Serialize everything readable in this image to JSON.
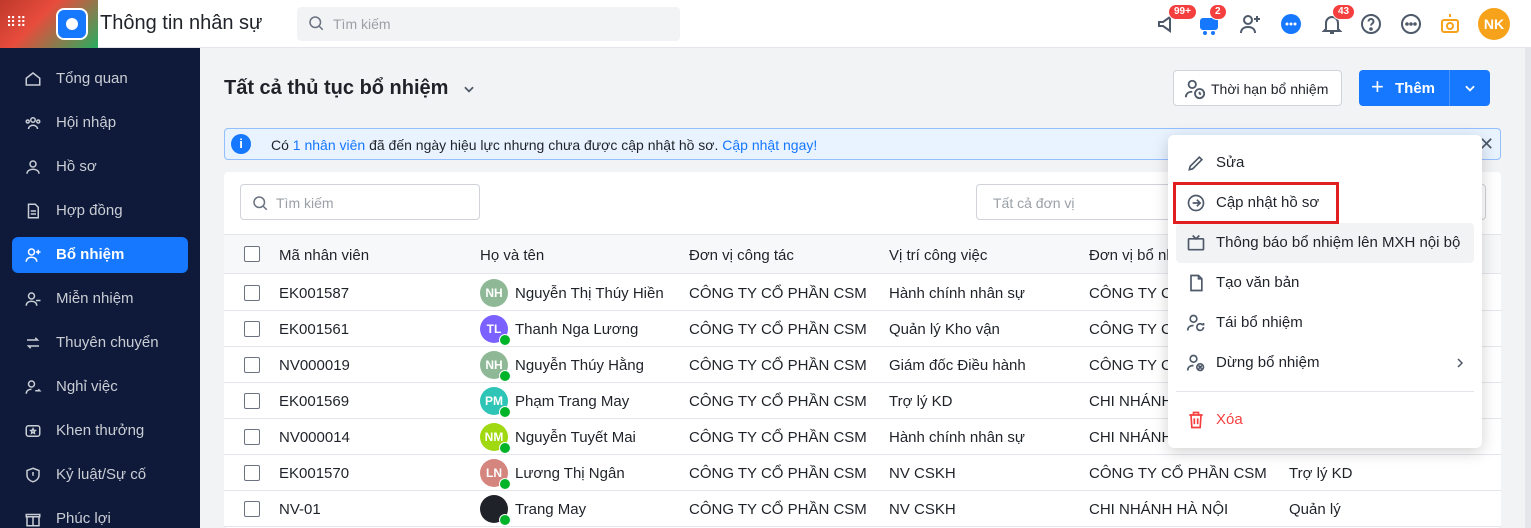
{
  "header": {
    "app_title": "Thông tin nhân sự",
    "search_placeholder": "Tìm kiếm",
    "badges": {
      "announce": "99+",
      "cart": "2",
      "notifications": "43"
    },
    "avatar_initials": "NK"
  },
  "sidebar": {
    "items": [
      {
        "label": "Tổng quan",
        "icon": "home-icon"
      },
      {
        "label": "Hội nhập",
        "icon": "users-group-icon"
      },
      {
        "label": "Hồ sơ",
        "icon": "user-icon"
      },
      {
        "label": "Hợp đồng",
        "icon": "document-icon"
      },
      {
        "label": "Bổ nhiệm",
        "icon": "user-plus-icon",
        "active": true
      },
      {
        "label": "Miễn nhiệm",
        "icon": "user-minus-icon"
      },
      {
        "label": "Thuyên chuyển",
        "icon": "transfer-icon"
      },
      {
        "label": "Nghỉ việc",
        "icon": "user-leave-icon"
      },
      {
        "label": "Khen thưởng",
        "icon": "award-icon"
      },
      {
        "label": "Kỷ luật/Sự cố",
        "icon": "shield-icon"
      },
      {
        "label": "Phúc lợi",
        "icon": "gift-icon"
      }
    ]
  },
  "main": {
    "title": "Tất cả thủ tục bổ nhiệm",
    "term_button": "Thời hạn bổ nhiệm",
    "add_button": "Thêm",
    "alert": {
      "prefix": "Có ",
      "count_link": "1 nhân viên",
      "middle": " đã đến ngày hiệu lực nhưng chưa được cập nhật hồ sơ. ",
      "action_link": "Cập nhật ngay!"
    },
    "filter_search_placeholder": "Tìm kiếm",
    "filter_unit_placeholder": "Tất cả đơn vị"
  },
  "table": {
    "columns": [
      "Mã nhân viên",
      "Họ và tên",
      "Đơn vị công tác",
      "Vị trí công việc",
      "Đơn vị bổ nh"
    ],
    "rows": [
      {
        "code": "EK001587",
        "initials": "NH",
        "color": "#8fb996",
        "name": "Nguyễn Thị Thúy Hiền",
        "unit": "CÔNG TY CỔ PHẦN CSM",
        "position": "Hành chính nhân sự",
        "new_unit": "CÔNG TY C",
        "new_pos": "",
        "verified": false
      },
      {
        "code": "EK001561",
        "initials": "TL",
        "color": "#7b61ff",
        "name": "Thanh Nga Lương",
        "unit": "CÔNG TY CỔ PHẦN CSM",
        "position": "Quản lý Kho vận",
        "new_unit": "CÔNG TY C",
        "new_pos": "",
        "verified": true
      },
      {
        "code": "NV000019",
        "initials": "NH",
        "color": "#8fb996",
        "name": "Nguyễn Thúy Hằng",
        "unit": "CÔNG TY CỔ PHẦN CSM",
        "position": "Giám đốc Điều hành",
        "new_unit": "CÔNG TY C",
        "new_pos": "",
        "verified": true
      },
      {
        "code": "EK001569",
        "initials": "PM",
        "color": "#2ec4b6",
        "name": "Phạm Trang May",
        "unit": "CÔNG TY CỔ PHẦN CSM",
        "position": "Trợ lý KD",
        "new_unit": "CHI NHÁNH",
        "new_pos": "",
        "verified": true
      },
      {
        "code": "NV000014",
        "initials": "NM",
        "color": "#a0d911",
        "name": "Nguyễn Tuyết Mai",
        "unit": "CÔNG TY CỔ PHẦN CSM",
        "position": "Hành chính nhân sự",
        "new_unit": "CHI NHÁNH",
        "new_pos": "",
        "verified": true
      },
      {
        "code": "EK001570",
        "initials": "LN",
        "color": "#d4867e",
        "name": "Lương Thị Ngân",
        "unit": "CÔNG TY CỔ PHẦN CSM",
        "position": "NV CSKH",
        "new_unit": "CÔNG TY CỔ PHẦN CSM",
        "new_pos": "Trợ lý KD",
        "verified": true
      },
      {
        "code": "NV-01",
        "initials": "",
        "color": "#1f2329",
        "name": "Trang May",
        "unit": "CÔNG TY CỔ PHẦN CSM",
        "position": "NV CSKH",
        "new_unit": "CHI NHÁNH HÀ NỘI",
        "new_pos": "Quản lý",
        "verified": true
      }
    ]
  },
  "context_menu": {
    "items": [
      {
        "label": "Sửa",
        "icon": "pencil-icon"
      },
      {
        "label": "Cập nhật hồ sơ",
        "icon": "arrow-circle-right-icon"
      },
      {
        "label": "Thông báo bổ nhiệm lên MXH nội bộ",
        "icon": "tv-icon"
      },
      {
        "label": "Tạo văn bản",
        "icon": "file-icon"
      },
      {
        "label": "Tái bổ nhiệm",
        "icon": "user-refresh-icon"
      },
      {
        "label": "Dừng bổ nhiệm",
        "icon": "user-stop-icon"
      },
      {
        "label": "Xóa",
        "icon": "trash-icon"
      }
    ]
  },
  "colors": {
    "primary": "#1677ff",
    "sidebar_bg": "#0f1a3a",
    "danger": "#f53f3f",
    "highlight_box": "#e02020"
  }
}
